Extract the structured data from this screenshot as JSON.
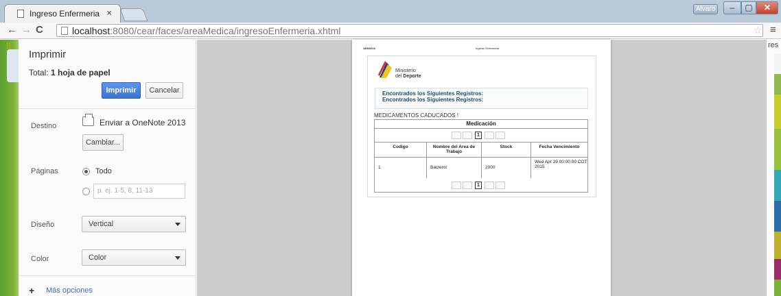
{
  "browser": {
    "tab_title": "Ingreso Enfermeria",
    "tab_close": "×",
    "user_badge": "Alvaro",
    "url_host": "localhost",
    "url_path": ":8080/cear/faces/areaMedica/ingresoEnfermeria.xhtml",
    "bookmarks_fragment": "res"
  },
  "print_panel": {
    "title": "Imprimir",
    "total_label": "Total:",
    "total_value": "1 hoja de papel",
    "print_button": "Imprimir",
    "cancel_button": "Cancelar",
    "destination_label": "Destino",
    "destination_value": "Enviar a OneNote 2013",
    "change_button": "Cambiar...",
    "pages_label": "Páginas",
    "pages_all": "Todo",
    "pages_placeholder": "p. ej. 1-5, 8, 11-13",
    "layout_label": "Diseño",
    "layout_value": "Vertical",
    "color_label": "Color",
    "color_value": "Color",
    "more_options": "Más opciones"
  },
  "preview": {
    "header_date": "18/5/2015",
    "header_title": "Ingreso Enfermeria",
    "logo_line1": "Ministerio",
    "logo_line2_prefix": "del ",
    "logo_line2_bold": "Deporte",
    "messages": [
      "Encontrados los Siguientes Registros:",
      "Encontrados los Siguientes Registros:"
    ],
    "expired_title": "MEDICAMENTOS CADUCADOS !",
    "table_title": "Medicación",
    "current_page": "1",
    "columns": [
      "Codigo",
      "Nombre del Area de Trabajo",
      "Stock",
      "Fecha Vencimiento"
    ],
    "rows": [
      [
        "1",
        "Bacterol",
        "2000",
        "Wed Apr 29 00:00:00 COT 2015"
      ]
    ]
  }
}
